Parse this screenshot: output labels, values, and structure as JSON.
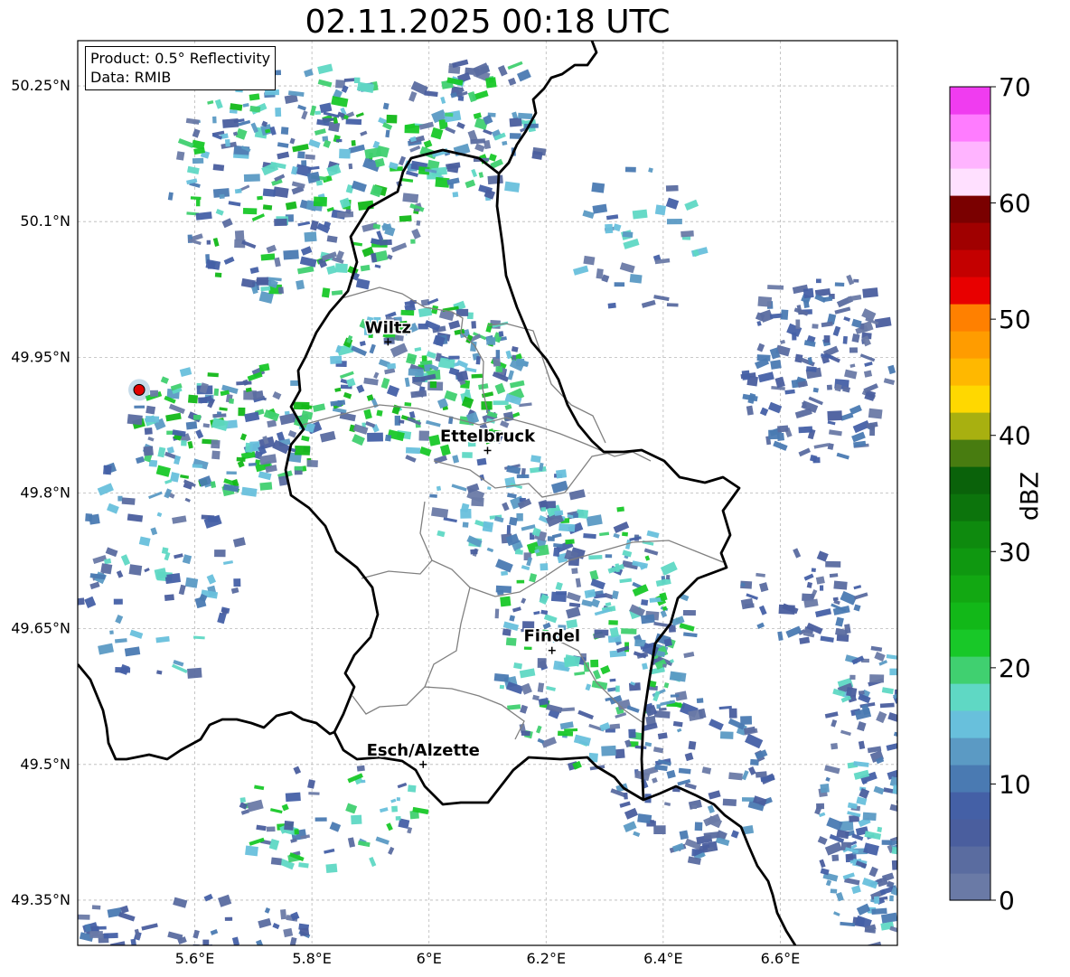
{
  "title": "02.11.2025 00:18 UTC",
  "info_box": {
    "product": "Product: 0.5° Reflectivity",
    "source": "Data: RMIB"
  },
  "map": {
    "lon_range": [
      5.4,
      6.8
    ],
    "lat_range": [
      49.3,
      50.3
    ],
    "lon_ticks": [
      {
        "value": 5.6,
        "label": "5.6°E"
      },
      {
        "value": 5.8,
        "label": "5.8°E"
      },
      {
        "value": 6.0,
        "label": "6°E"
      },
      {
        "value": 6.2,
        "label": "6.2°E"
      },
      {
        "value": 6.4,
        "label": "6.4°E"
      },
      {
        "value": 6.6,
        "label": "6.6°E"
      }
    ],
    "lat_ticks": [
      {
        "value": 49.35,
        "label": "49.35°N"
      },
      {
        "value": 49.5,
        "label": "49.5°N"
      },
      {
        "value": 49.65,
        "label": "49.65°N"
      },
      {
        "value": 49.8,
        "label": "49.8°N"
      },
      {
        "value": 49.95,
        "label": "49.95°N"
      },
      {
        "value": 50.1,
        "label": "50.1°N"
      },
      {
        "value": 50.25,
        "label": "50.25°N"
      }
    ],
    "radar_site": {
      "lon": 5.505,
      "lat": 49.914
    },
    "cities": [
      {
        "name": "Wiltz",
        "lon": 5.93,
        "lat": 49.967
      },
      {
        "name": "Ettelbruck",
        "lon": 6.1,
        "lat": 49.847
      },
      {
        "name": "Findel",
        "lon": 6.21,
        "lat": 49.626
      },
      {
        "name": "Esch/Alzette",
        "lon": 5.99,
        "lat": 49.5
      }
    ]
  },
  "colorbar": {
    "label": "dBZ",
    "min": 0,
    "max": 70,
    "ticks": [
      {
        "value": 0,
        "label": "0"
      },
      {
        "value": 10,
        "label": "10"
      },
      {
        "value": 20,
        "label": "20"
      },
      {
        "value": 30,
        "label": "30"
      },
      {
        "value": 40,
        "label": "40"
      },
      {
        "value": 50,
        "label": "50"
      },
      {
        "value": 60,
        "label": "60"
      },
      {
        "value": 70,
        "label": "70"
      }
    ],
    "colors": [
      "#6a7aa6",
      "#5a6ca0",
      "#4a5e9e",
      "#4460a6",
      "#4a7ab2",
      "#5b9ac4",
      "#68c0dc",
      "#5fd8c4",
      "#40d070",
      "#18c828",
      "#12b818",
      "#12a812",
      "#0f9810",
      "#0e8a0e",
      "#0c740c",
      "#0a620a",
      "#487c10",
      "#a8b010",
      "#ffd800",
      "#ffb800",
      "#ff9c00",
      "#ff8000",
      "#e80000",
      "#c40000",
      "#a00000",
      "#7a0000",
      "#ffe0ff",
      "#ffb4ff",
      "#ff7cff",
      "#f03cf0"
    ]
  }
}
